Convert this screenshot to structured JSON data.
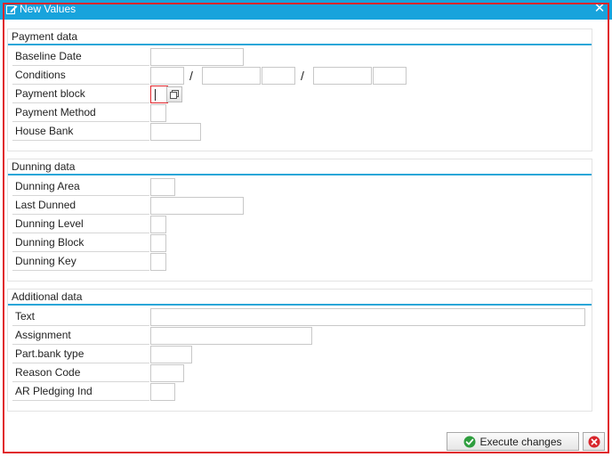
{
  "window": {
    "title": "New Values",
    "close_glyph": "✕"
  },
  "payment": {
    "title": "Payment data",
    "labels": {
      "baseline_date": "Baseline Date",
      "conditions": "Conditions",
      "payment_block": "Payment block",
      "payment_method": "Payment Method",
      "house_bank": "House Bank"
    },
    "separator": "/"
  },
  "dunning": {
    "title": "Dunning data",
    "labels": {
      "dunning_area": "Dunning Area",
      "last_dunned": "Last Dunned",
      "dunning_level": "Dunning Level",
      "dunning_block": "Dunning Block",
      "dunning_key": "Dunning Key"
    }
  },
  "additional": {
    "title": "Additional data",
    "labels": {
      "text": "Text",
      "assignment": "Assignment",
      "part_bank_type": "Part.bank type",
      "reason_code": "Reason Code",
      "ar_pledging_ind": "AR Pledging Ind"
    }
  },
  "footer": {
    "execute_label": "Execute changes"
  },
  "icons": {
    "title": "edit-icon",
    "execute": "checkmark-icon",
    "cancel": "cancel-icon"
  },
  "colors": {
    "titlebar": "#18a3dc",
    "section_line": "#2aa6d8",
    "frame": "#e0262c",
    "execute_icon": "#2e9e3e",
    "cancel_icon": "#d8262c"
  }
}
